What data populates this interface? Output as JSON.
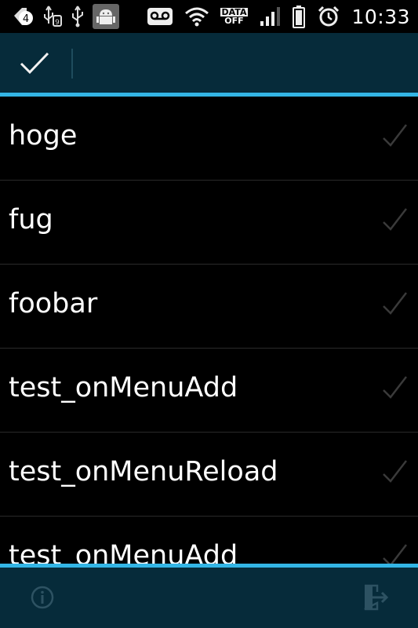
{
  "status_bar": {
    "notification_count": "4",
    "data_label": "DATA",
    "off_label": "OFF",
    "time": "10:33"
  },
  "action_bar": {
    "done_icon": "checkmark-icon"
  },
  "list": {
    "items": [
      {
        "label": "hoge"
      },
      {
        "label": "fug"
      },
      {
        "label": "foobar"
      },
      {
        "label": "test_onMenuAdd"
      },
      {
        "label": "test_onMenuReload"
      },
      {
        "label": "test_onMenuAdd"
      }
    ]
  },
  "bottom_bar": {
    "left_icon": "info-icon",
    "right_icon": "exit-icon"
  },
  "colors": {
    "accent": "#33b5e5",
    "bar_background": "#062b3a",
    "list_background": "#000000"
  }
}
